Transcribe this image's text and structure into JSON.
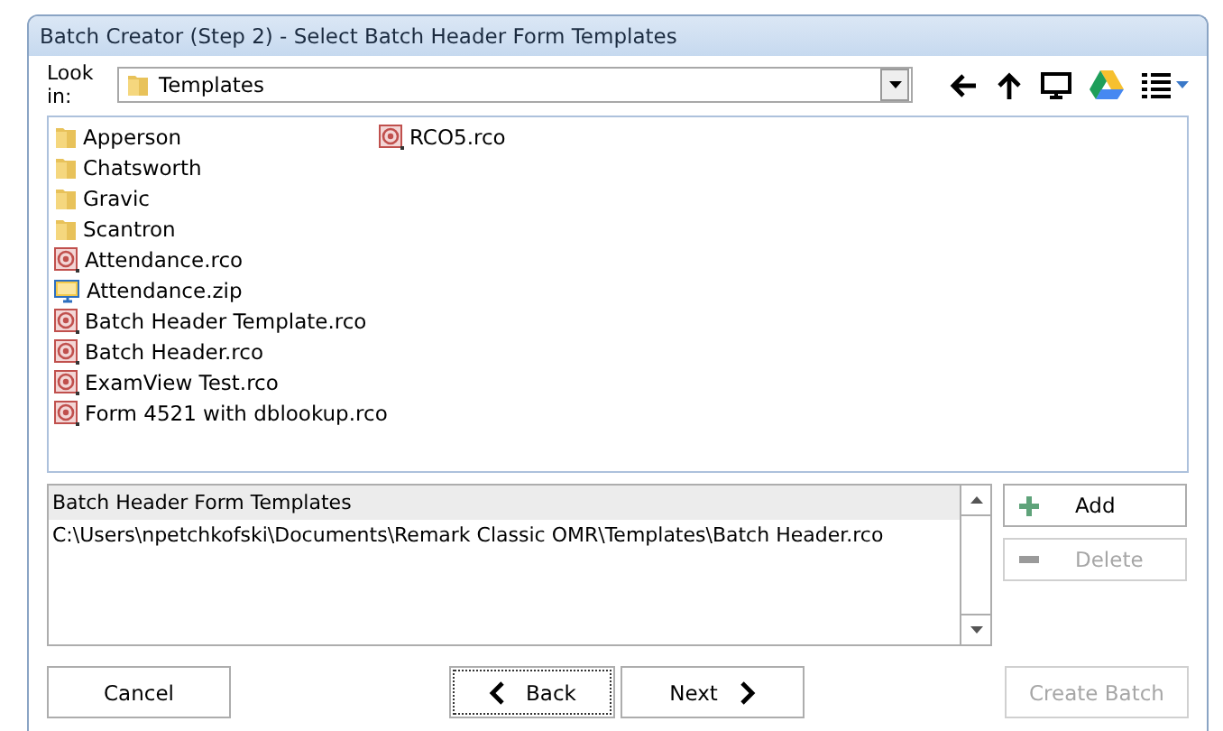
{
  "window": {
    "title": "Batch Creator (Step 2) - Select Batch Header Form Templates"
  },
  "look_in": {
    "label": "Look in:",
    "value": "Templates"
  },
  "files": [
    {
      "name": "Apperson",
      "kind": "folder"
    },
    {
      "name": "Chatsworth",
      "kind": "folder"
    },
    {
      "name": "Gravic",
      "kind": "folder"
    },
    {
      "name": "Scantron",
      "kind": "folder"
    },
    {
      "name": "Attendance.rco",
      "kind": "rco"
    },
    {
      "name": "Attendance.zip",
      "kind": "zip"
    },
    {
      "name": "Batch Header Template.rco",
      "kind": "rco"
    },
    {
      "name": "Batch Header.rco",
      "kind": "rco"
    },
    {
      "name": "ExamView Test.rco",
      "kind": "rco"
    },
    {
      "name": "Form 4521 with dblookup.rco",
      "kind": "rco"
    },
    {
      "name": "RCO5.rco",
      "kind": "rco"
    }
  ],
  "selected_list": {
    "header": "Batch Header Form Templates",
    "rows": [
      "C:\\Users\\npetchkofski\\Documents\\Remark Classic OMR\\Templates\\Batch Header.rco"
    ]
  },
  "side_buttons": [
    {
      "label": "Add",
      "kind": "add",
      "disabled": false
    },
    {
      "label": "Delete",
      "kind": "delete",
      "disabled": true
    }
  ],
  "footer_buttons": [
    {
      "label": "Cancel",
      "kind": "plain",
      "disabled": false,
      "focused": false
    },
    {
      "label": "Back",
      "kind": "back",
      "disabled": false,
      "focused": true
    },
    {
      "label": "Next",
      "kind": "next",
      "disabled": false,
      "focused": false
    },
    {
      "label": "Create Batch",
      "kind": "plain",
      "disabled": true,
      "focused": false
    }
  ]
}
